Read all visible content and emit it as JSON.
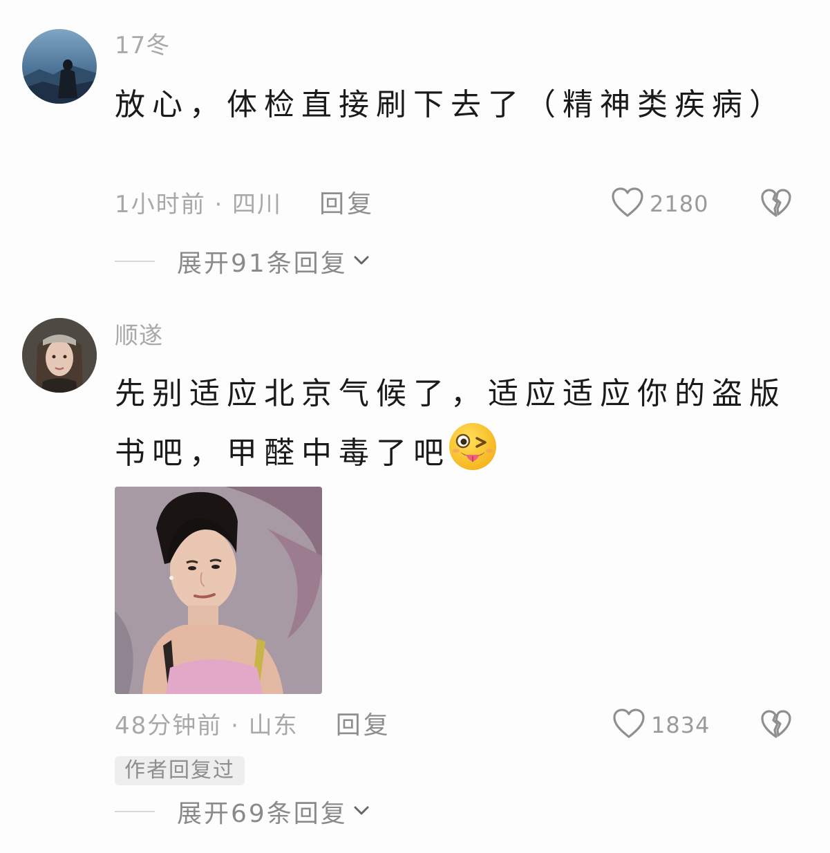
{
  "comments": [
    {
      "username": "17冬",
      "text": "放心，体检直接刷下去了（精神类疾病）",
      "time_location": "1小时前 · 四川",
      "reply_label": "回复",
      "likes": "2180",
      "expand_label": "展开91条回复"
    },
    {
      "username": "顺遂",
      "text": "先别适应北京气候了，适应适应你的盗版书吧，甲醛中毒了吧",
      "emoji": "wink-tongue-emoji",
      "time_location": "48分钟前 · 山东",
      "reply_label": "回复",
      "likes": "1834",
      "author_badge": "作者回复过",
      "expand_label": "展开69条回复"
    }
  ],
  "icons": {
    "like": "heart-outline-icon",
    "dislike": "broken-heart-icon",
    "expand": "chevron-down-icon"
  },
  "colors": {
    "background": "#fdfdfd",
    "text": "#1a1a1a",
    "muted": "#a8a8a8"
  }
}
